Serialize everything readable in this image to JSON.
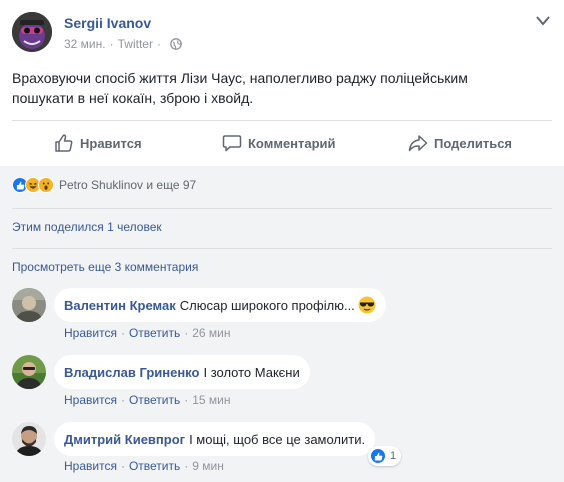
{
  "post": {
    "author": "Sergii Ivanov",
    "time": "32 мин.",
    "source": "Twitter",
    "text": "Враховуючи спосіб життя Лізи Чаус, наполегливо раджу поліцейським пошукати в неї кокаїн, зброю і хвойд."
  },
  "actions": {
    "like": "Нравится",
    "comment": "Комментарий",
    "share": "Поделиться"
  },
  "reactions": {
    "summary": "Petro Shuklinov и еще 97"
  },
  "shared": "Этим поделился 1 человек",
  "more_comments": "Просмотреть еще 3 комментария",
  "comments": [
    {
      "name": "Валентин Кремак",
      "text": "Слюсар широкого профілю...",
      "like": "Нравится",
      "reply": "Ответить",
      "time": "26 мин"
    },
    {
      "name": "Владислав Гриненко",
      "text": "І золото Макєни",
      "like": "Нравится",
      "reply": "Ответить",
      "time": "15 мин"
    },
    {
      "name": "Дмитрий Киевпрог",
      "text": "І мощі, щоб все це замолити.",
      "like": "Нравится",
      "reply": "Ответить",
      "time": "9 мин",
      "reaction_count": "1"
    }
  ],
  "icons": {
    "globe": "globe-icon",
    "menu": "chevron-down-icon",
    "like": "thumbs-up-icon",
    "comment": "speech-bubble-icon",
    "share": "share-arrow-icon"
  },
  "colors": {
    "link": "#385898",
    "muted": "#90949c",
    "like_blue": "#1877f2"
  }
}
